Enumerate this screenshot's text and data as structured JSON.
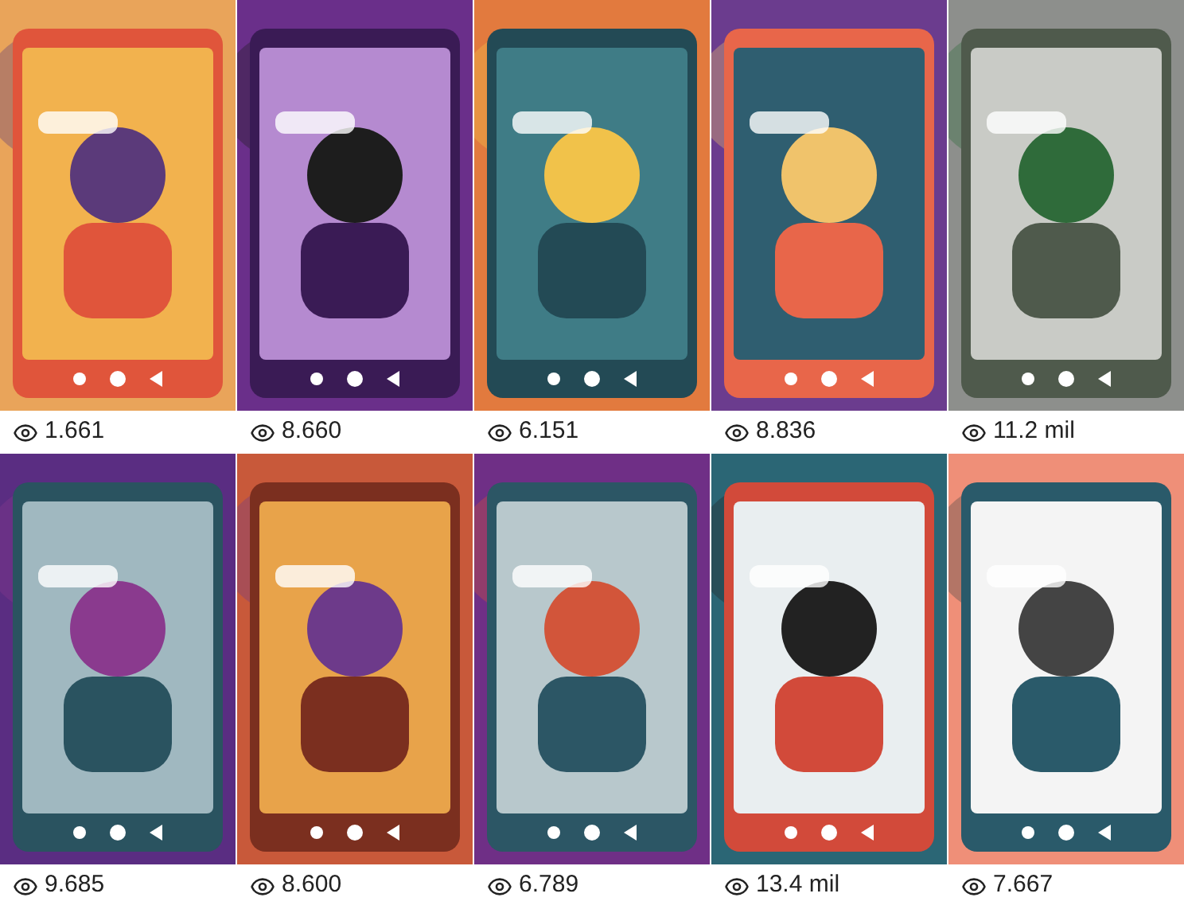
{
  "posts": [
    {
      "kind": "picture",
      "views": "1.661"
    },
    {
      "kind": "picture",
      "views": "8.660"
    },
    {
      "kind": "picture",
      "views": "6.151"
    },
    {
      "kind": "picture",
      "views": "8.836"
    },
    {
      "kind": "picture",
      "views": "11.2 mil"
    },
    {
      "kind": "picture",
      "views": "9.685"
    },
    {
      "kind": "picture",
      "views": "8.600"
    },
    {
      "kind": "picture",
      "views": "6.789"
    },
    {
      "kind": "picture",
      "views": "13.4 mil"
    },
    {
      "kind": "picture",
      "views": "7.667"
    }
  ]
}
